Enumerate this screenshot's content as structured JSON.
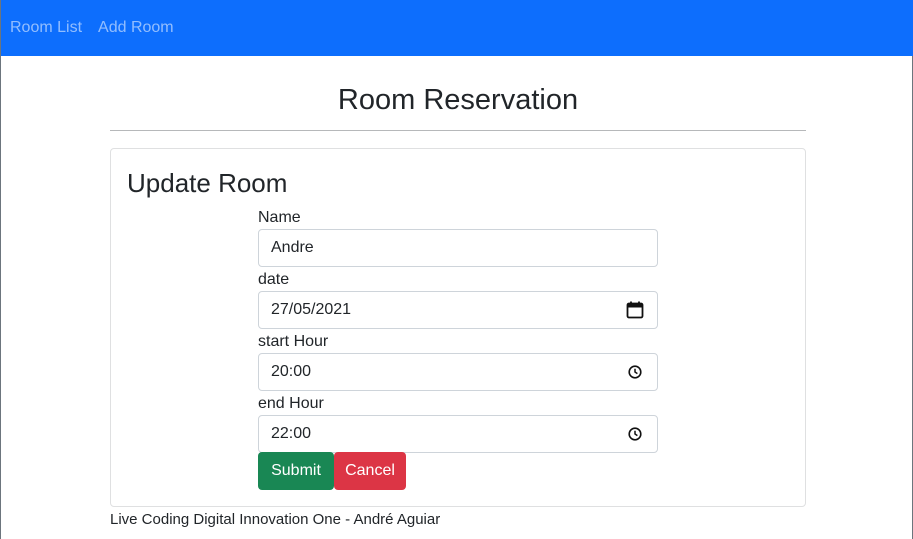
{
  "nav": {
    "items": [
      {
        "label": "Room List"
      },
      {
        "label": "Add Room"
      }
    ]
  },
  "page": {
    "title": "Room Reservation"
  },
  "card": {
    "title": "Update Room",
    "fields": {
      "name": {
        "label": "Name",
        "value": "Andre"
      },
      "date": {
        "label": "date",
        "value": "27/05/2021",
        "icon": "calendar-icon"
      },
      "start_hour": {
        "label": "start Hour",
        "value": "20:00",
        "icon": "clock-icon"
      },
      "end_hour": {
        "label": "end Hour",
        "value": "22:00",
        "icon": "clock-icon"
      }
    },
    "buttons": {
      "submit": "Submit",
      "cancel": "Cancel"
    }
  },
  "footer": {
    "text": "Live Coding Digital Innovation One - André Aguiar"
  },
  "colors": {
    "navbar": "#0d6efd",
    "submit": "#198754",
    "cancel": "#dc3545"
  }
}
